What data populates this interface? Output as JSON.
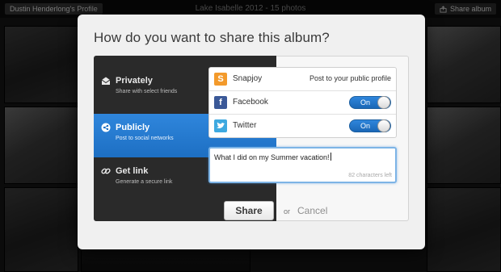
{
  "gallery": {
    "profile_label": "Dustin Henderlong's Profile",
    "album_title": "Lake Isabelle 2012 - 15 photos",
    "share_album_label": "Share album"
  },
  "modal": {
    "title": "How do you want to share this album?",
    "options": [
      {
        "title": "Privately",
        "subtitle": "Share with select friends",
        "icon": "envelope-icon",
        "active": false
      },
      {
        "title": "Publicly",
        "subtitle": "Post to social networks",
        "icon": "share-network-icon",
        "active": true
      },
      {
        "title": "Get link",
        "subtitle": "Generate a secure link",
        "icon": "link-icon",
        "active": false
      }
    ],
    "networks": [
      {
        "name": "Snapjoy",
        "icon": "snapjoy-icon",
        "status": "Post to your public profile",
        "color": "#f39a2b"
      },
      {
        "name": "Facebook",
        "icon": "facebook-icon",
        "toggle": "On",
        "color": "#3b5998"
      },
      {
        "name": "Twitter",
        "icon": "twitter-icon",
        "toggle": "On",
        "color": "#3ea9e0"
      }
    ],
    "message": {
      "value": "What I did on my Summer vacation!",
      "chars_left": "82 characters left"
    },
    "share_label": "Share",
    "or_label": "or",
    "cancel_label": "Cancel"
  },
  "colors": {
    "accent": "#2a7fd6",
    "panel_dark": "#2a2a2a",
    "modal_bg": "#f0f0f0"
  }
}
